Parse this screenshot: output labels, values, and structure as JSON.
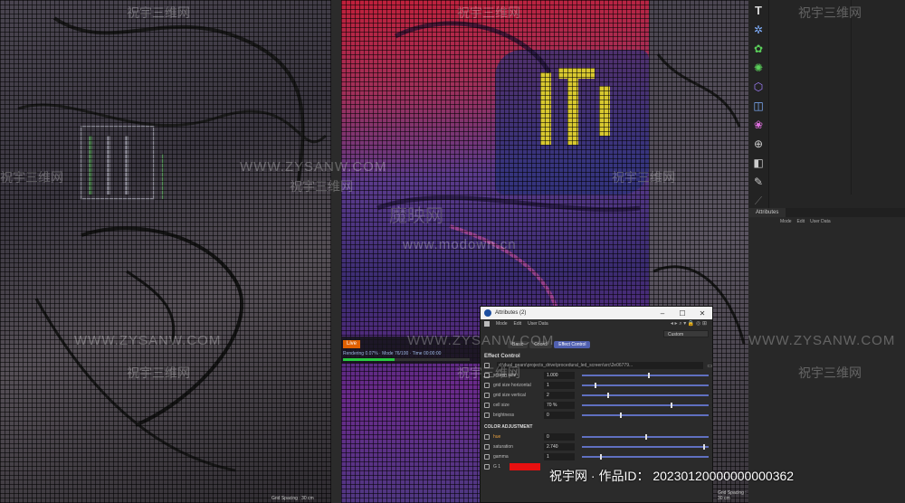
{
  "render": {
    "tag": "Live",
    "status": "Rendering 0.07% · Mode 76/100 · Time 00:00:00",
    "progress": 0.41
  },
  "viewport": {
    "grid_spacing_left": "Grid Spacing : 30 cm",
    "grid_spacing_right": "Grid Spacing : 30 cm"
  },
  "toolbar": {
    "text_icon": "T",
    "tools": [
      "nurbs-icon",
      "generator-icon",
      "deformer-icon",
      "camera-icon",
      "light-icon",
      "material-icon",
      "tag-icon",
      "render-icon",
      "script-icon"
    ]
  },
  "attr_panel": {
    "tab_label": "Attributes",
    "menu": [
      "Mode",
      "Edit",
      "User Data"
    ]
  },
  "float_window": {
    "title": "Attributes (2)",
    "menu": [
      "Mode",
      "Edit",
      "User Data"
    ],
    "mode_select": "Custom",
    "tabs": [
      "Basic",
      "Coord.",
      "Effect Control"
    ],
    "active_tab": 2,
    "section": "Effect Control",
    "path": "d:\\dual_gears\\projects_drive\\procedural_led_screen\\src\\2e06779..."
  },
  "params": [
    {
      "label": "screen size",
      "value": "1.000",
      "level": 0.52
    },
    {
      "label": "grid size horizontal",
      "value": "1",
      "level": 0.1
    },
    {
      "label": "grid size vertical",
      "value": "2",
      "level": 0.2
    },
    {
      "label": "cell size",
      "value": "70 %",
      "level": 0.7
    },
    {
      "label": "brightness",
      "value": "0",
      "level": 0.3
    }
  ],
  "color_adjust": {
    "title": "COLOR ADJUSTMENT",
    "params": [
      {
        "label": "hue",
        "value": "0",
        "level": 0.5,
        "accent": true
      },
      {
        "label": "saturation",
        "value": "2.740",
        "level": 0.96,
        "accent": false
      },
      {
        "label": "gamma",
        "value": "1",
        "level": 0.14,
        "accent": false
      }
    ],
    "color_label": "G 1",
    "color": "#e81010"
  },
  "watermarks": {
    "cn": "祝宇三维网",
    "en": "WWW.ZYSANW.COM",
    "site_cn": "魔映网",
    "site_en": "www.modown.cn",
    "work_id": "祝宇网 · 作品ID： 20230120000000000362"
  },
  "colors": {
    "accent_slider": "#6070c0",
    "progress": "#28c840",
    "render_tag": "#e06000"
  }
}
